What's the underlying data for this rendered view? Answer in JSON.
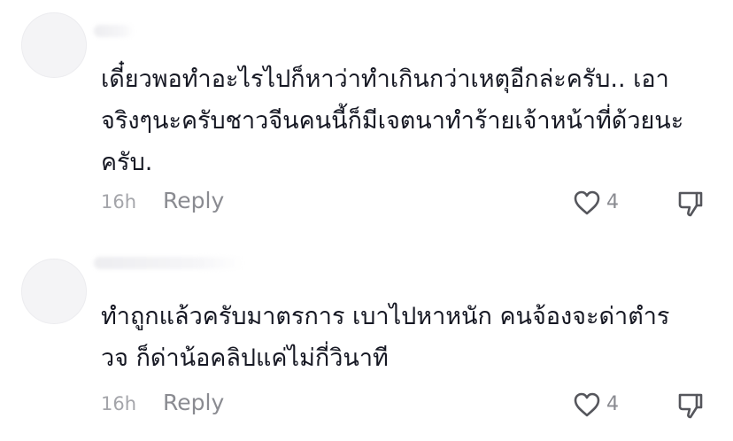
{
  "comments": [
    {
      "text": "เดี๋ยวพอทำอะไรไปก็หาว่าทำเกินกว่าเหตุอีกล่ะครับ.. เอา\nจริงๆนะครับชาวจีนคนนี้ก็มีเจตนาทำร้ายเจ้าหน้าที่ด้วยนะ\nครับ.",
      "time": "16h",
      "reply_label": "Reply",
      "likes": "4"
    },
    {
      "text": "ทำถูกแล้วครับมาตรการ เบาไปหาหนัก คนจ้องจะด่าตำร\nวจ ก็ด่าน้อคลิปแค่ไม่กี่วินาที",
      "time": "16h",
      "reply_label": "Reply",
      "likes": "4"
    }
  ],
  "icons": {
    "like": "heart-outline-icon",
    "dislike": "thumbs-down-icon"
  },
  "colors": {
    "text": "#161823",
    "muted": "#8a8b91",
    "time": "#a4a5aa",
    "icon": "#55565c"
  }
}
